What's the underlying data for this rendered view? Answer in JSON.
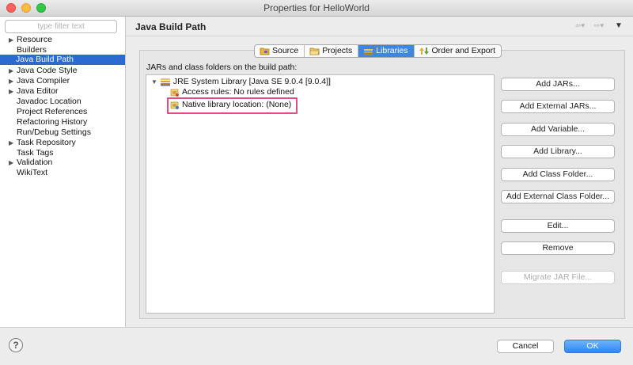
{
  "window": {
    "title": "Properties for HelloWorld"
  },
  "filter": {
    "placeholder": "type filter text"
  },
  "sidebar": {
    "items": [
      {
        "label": "Resource",
        "expandable": true
      },
      {
        "label": "Builders",
        "expandable": false
      },
      {
        "label": "Java Build Path",
        "expandable": false,
        "selected": true
      },
      {
        "label": "Java Code Style",
        "expandable": true
      },
      {
        "label": "Java Compiler",
        "expandable": true
      },
      {
        "label": "Java Editor",
        "expandable": true
      },
      {
        "label": "Javadoc Location",
        "expandable": false
      },
      {
        "label": "Project References",
        "expandable": false
      },
      {
        "label": "Refactoring History",
        "expandable": false
      },
      {
        "label": "Run/Debug Settings",
        "expandable": false
      },
      {
        "label": "Task Repository",
        "expandable": true
      },
      {
        "label": "Task Tags",
        "expandable": false
      },
      {
        "label": "Validation",
        "expandable": true
      },
      {
        "label": "WikiText",
        "expandable": false
      }
    ]
  },
  "header": {
    "title": "Java Build Path"
  },
  "tabs": [
    {
      "label": "Source",
      "icon": "source-folder-icon"
    },
    {
      "label": "Projects",
      "icon": "projects-folder-icon"
    },
    {
      "label": "Libraries",
      "icon": "library-icon",
      "active": true
    },
    {
      "label": "Order and Export",
      "icon": "order-export-icon"
    }
  ],
  "libraries": {
    "label": "JARs and class folders on the build path:",
    "jre": "JRE System Library [Java SE 9.0.4 [9.0.4]]",
    "access_rules": "Access rules: No rules defined",
    "native_location": "Native library location: (None)"
  },
  "buttons": {
    "add_jars": "Add JARs...",
    "add_external_jars": "Add External JARs...",
    "add_variable": "Add Variable...",
    "add_library": "Add Library...",
    "add_class_folder": "Add Class Folder...",
    "add_external_class_folder": "Add External Class Folder...",
    "edit": "Edit...",
    "remove": "Remove",
    "migrate_jar": "Migrate JAR File..."
  },
  "footer": {
    "help": "?",
    "cancel": "Cancel",
    "ok": "OK"
  },
  "colors": {
    "selection": "#2b6ad1",
    "active_tab": "#3d87e0",
    "ok_button": "#2f86f4",
    "highlight_box": "#e34b85"
  }
}
